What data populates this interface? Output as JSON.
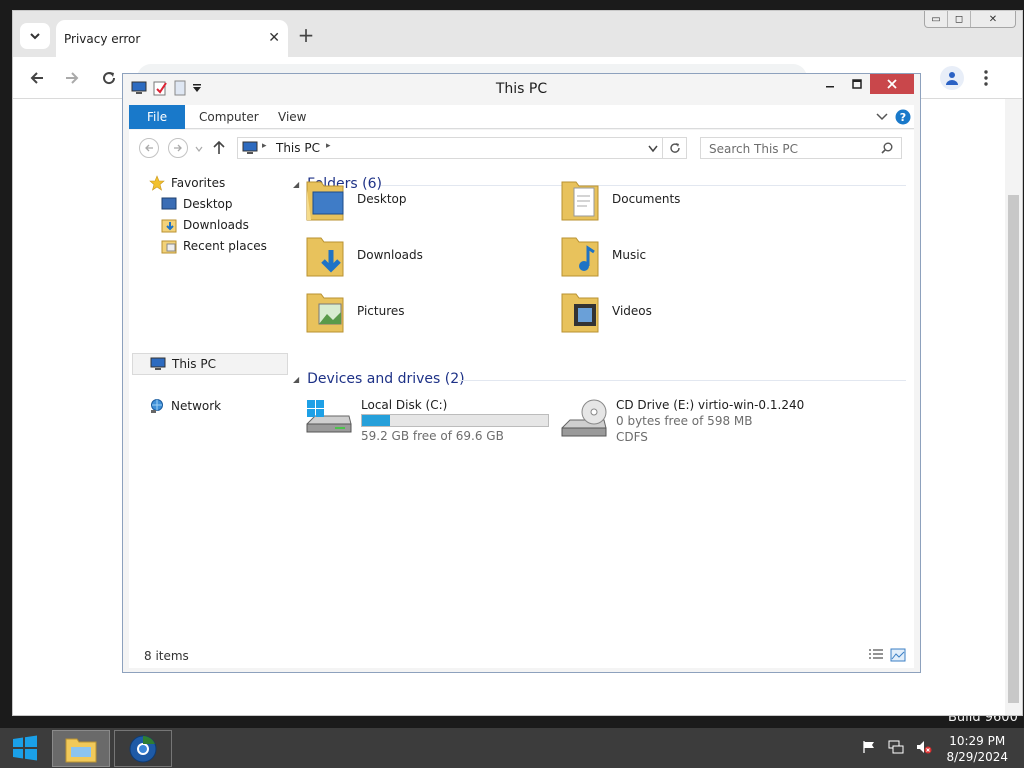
{
  "desktop": {
    "build_text": "Build 9600"
  },
  "chrome": {
    "tab_title": "Privacy error",
    "tab_close": "✕",
    "new_tab": "+",
    "window_controls": {
      "minimize": "▭",
      "maximize": "◻",
      "close": "✕"
    }
  },
  "explorer": {
    "title": "This PC",
    "ribbon_tabs": [
      "File",
      "Computer",
      "View"
    ],
    "address": {
      "location": "This PC"
    },
    "search": {
      "placeholder": "Search This PC"
    },
    "nav": {
      "favorites": "Favorites",
      "desktop": "Desktop",
      "downloads": "Downloads",
      "recent": "Recent places",
      "this_pc": "This PC",
      "network": "Network"
    },
    "folders": {
      "header": "Folders (6)",
      "items": [
        "Desktop",
        "Documents",
        "Downloads",
        "Music",
        "Pictures",
        "Videos"
      ]
    },
    "devices": {
      "header": "Devices and drives (2)",
      "local_disk": {
        "name": "Local Disk (C:)",
        "free": "59.2 GB free of 69.6 GB",
        "used_fraction": 0.15
      },
      "cd_drive": {
        "name": "CD Drive (E:) virtio-win-0.1.240",
        "free": "0 bytes free of 598 MB",
        "fs": "CDFS"
      }
    },
    "status": {
      "items": "8 items"
    }
  },
  "taskbar": {
    "time": "10:29 PM",
    "date": "8/29/2024"
  },
  "colors": {
    "accent": "#1979ca",
    "close": "#c9474b",
    "drive_bar": "#26a0da"
  }
}
